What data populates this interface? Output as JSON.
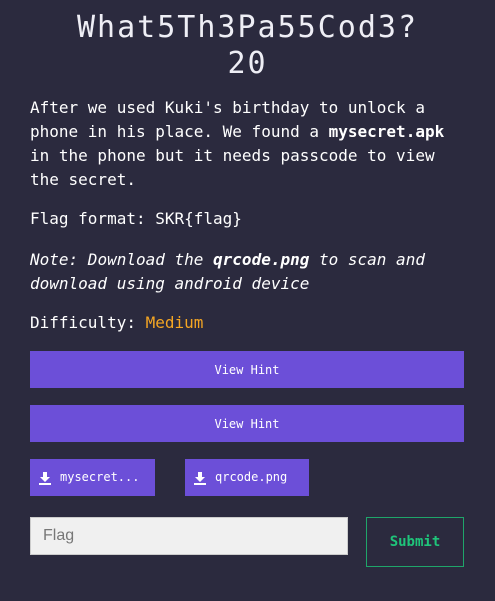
{
  "challenge": {
    "title": "What5Th3Pa55Cod3?",
    "points": "20",
    "description": {
      "part1": "After we used Kuki's birthday to unlock a phone in his place. We found a ",
      "apk_name": "mysecret.apk",
      "part2": " in the phone but it needs passcode to view the secret."
    },
    "flag_format": "Flag format: SKR{flag}",
    "note": {
      "prefix": "Note:",
      "part1": " Download the ",
      "file": "qrcode.png",
      "part2": " to scan and download using android device"
    },
    "difficulty_label": "Difficulty:",
    "difficulty_value": "Medium",
    "difficulty_color": "#f5a623"
  },
  "hints": [
    {
      "label": "View Hint"
    },
    {
      "label": "View Hint"
    }
  ],
  "files": [
    {
      "label": "mysecret...",
      "icon": "download-icon"
    },
    {
      "label": "qrcode.png",
      "icon": "download-icon"
    }
  ],
  "form": {
    "flag_placeholder": "Flag",
    "flag_value": "",
    "submit_label": "Submit"
  },
  "colors": {
    "background": "#2b2a3e",
    "accent": "#6c4fd8",
    "submit": "#1fc47a"
  }
}
